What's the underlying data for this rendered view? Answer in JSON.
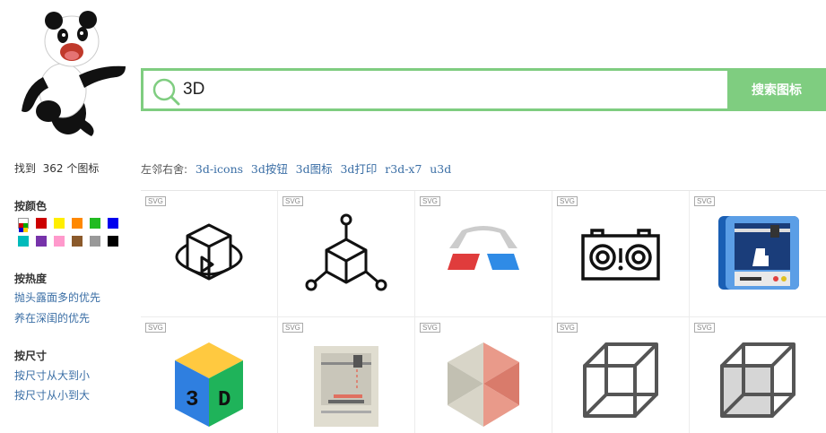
{
  "search": {
    "value": "3D",
    "button_label": "搜索图标"
  },
  "results": {
    "found_text": "找到  362 个图标"
  },
  "neighbors": {
    "label": "左邻右舍:",
    "links": [
      "3d-icons",
      "3d按钮",
      "3d图标",
      "3d打印",
      "r3d-x7",
      "u3d"
    ]
  },
  "filters": {
    "color": {
      "heading": "按颜色",
      "swatches": [
        "all",
        "#cc0000",
        "#ffee00",
        "#ff8800",
        "#22bb22",
        "#0000ee",
        "#00bbbb",
        "#7733aa",
        "#ff99cc",
        "#8b5a2b",
        "#999999",
        "#000000"
      ]
    },
    "popularity": {
      "heading": "按热度",
      "options": [
        "抛头露面多的优先",
        "养在深闺的优先"
      ]
    },
    "size": {
      "heading": "按尺寸",
      "options": [
        "按尺寸从大到小",
        "按尺寸从小到大"
      ]
    }
  },
  "icons": [
    {
      "tag": "SVG",
      "icon": "cube-rotate-icon"
    },
    {
      "tag": "SVG",
      "icon": "cube-nodes-icon"
    },
    {
      "tag": "SVG",
      "icon": "3d-glasses-icon"
    },
    {
      "tag": "SVG",
      "icon": "camera-3d-icon"
    },
    {
      "tag": "SVG",
      "icon": "3d-printer-blue-icon"
    },
    {
      "tag": "SVG",
      "icon": "3d-cube-colored-icon"
    },
    {
      "tag": "SVG",
      "icon": "3d-printer-gray-icon"
    },
    {
      "tag": "SVG",
      "icon": "hexagon-cube-icon"
    },
    {
      "tag": "SVG",
      "icon": "wireframe-cube-icon"
    },
    {
      "tag": "SVG",
      "icon": "gray-cube-icon"
    }
  ]
}
